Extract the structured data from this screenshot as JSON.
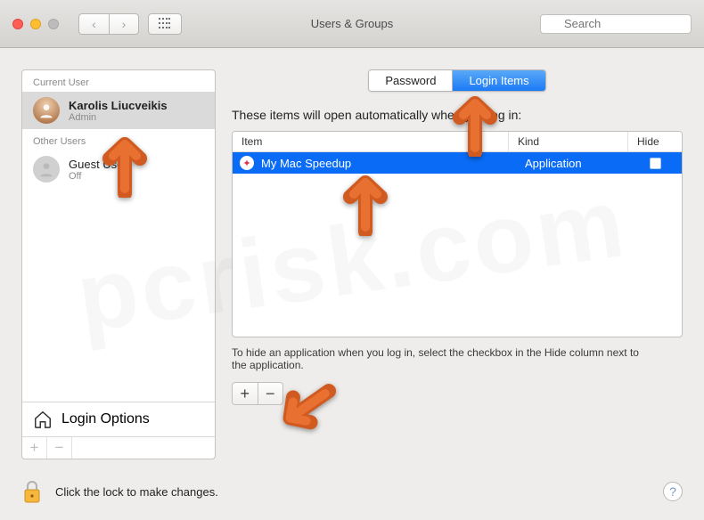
{
  "window": {
    "title": "Users & Groups",
    "search_placeholder": "Search"
  },
  "sidebar": {
    "current_user_label": "Current User",
    "other_users_label": "Other Users",
    "current_user": {
      "name": "Karolis Liucveikis",
      "role": "Admin"
    },
    "other_users": [
      {
        "name": "Guest User",
        "status": "Off"
      }
    ],
    "login_options_label": "Login Options",
    "add_label": "+",
    "remove_label": "−"
  },
  "tabs": {
    "password": "Password",
    "login_items": "Login Items"
  },
  "main": {
    "intro": "These items will open automatically when you log in:",
    "columns": {
      "item": "Item",
      "kind": "Kind",
      "hide": "Hide"
    },
    "rows": [
      {
        "name": "My Mac Speedup",
        "kind": "Application",
        "hide": false
      }
    ],
    "hint": "To hide an application when you log in, select the checkbox in the Hide column next to the application.",
    "add_label": "+",
    "remove_label": "−"
  },
  "footer": {
    "lock_text": "Click the lock to make changes.",
    "help": "?"
  },
  "icons": {
    "nav_back": "‹",
    "nav_fwd": "›",
    "compass": "✦"
  }
}
